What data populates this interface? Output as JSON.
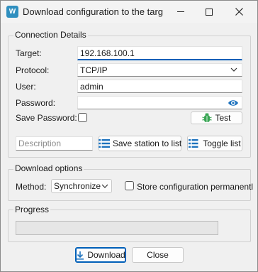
{
  "window": {
    "title": "Download configuration to the targ",
    "app_icon_letter": "W"
  },
  "connection": {
    "group_label": "Connection Details",
    "target_label": "Target:",
    "target_value": "192.168.100.1",
    "protocol_label": "Protocol:",
    "protocol_value": "TCP/IP",
    "user_label": "User:",
    "user_value": "admin",
    "password_label": "Password:",
    "password_value": "",
    "save_password_label": "Save Password:",
    "save_password_checked": false,
    "test_button": "Test"
  },
  "station": {
    "description_placeholder": "Description",
    "save_button": "Save station to list",
    "toggle_button": "Toggle list"
  },
  "download_options": {
    "group_label": "Download options",
    "method_label": "Method:",
    "method_value": "Synchronize",
    "store_permanent_label": "Store configuration permanentl",
    "store_permanent_checked": false
  },
  "progress": {
    "group_label": "Progress",
    "value": 0
  },
  "footer": {
    "download_button": "Download",
    "close_button": "Close"
  },
  "colors": {
    "accent": "#005fb8",
    "app_icon": "#2f8fbf",
    "bug_icon": "#3aa655",
    "list_icon": "#1e73be"
  }
}
